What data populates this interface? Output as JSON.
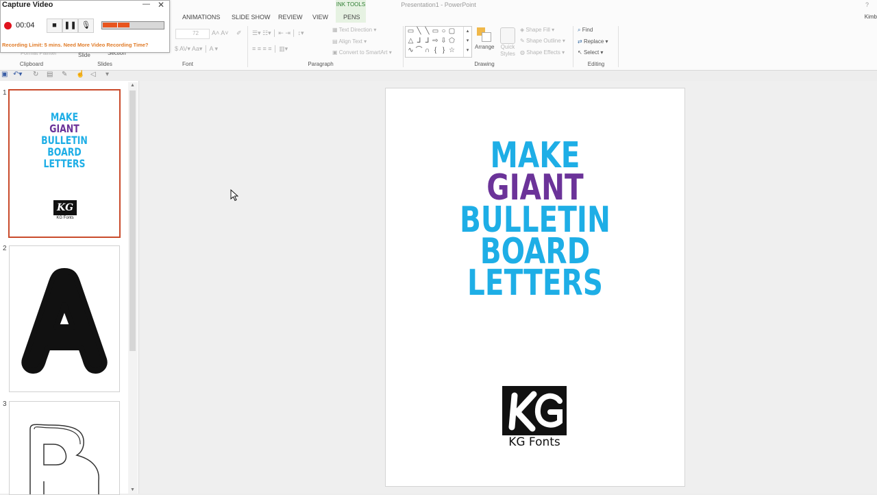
{
  "window": {
    "title": "Presentation1 - PowerPoint",
    "help": "?",
    "user": "Kimb"
  },
  "ribbon": {
    "context_tab_group": "INK TOOLS",
    "tabs": [
      "ANIMATIONS",
      "SLIDE SHOW",
      "REVIEW",
      "VIEW",
      "PENS"
    ],
    "clipboard": {
      "format_painter": "Format Painter",
      "label": "Clipboard"
    },
    "slides": {
      "slide": "Slide",
      "section": "Section",
      "label": "Slides"
    },
    "font": {
      "size": "72",
      "label": "Font"
    },
    "paragraph": {
      "text_direction": "Text Direction",
      "align_text": "Align Text",
      "convert_smartart": "Convert to SmartArt",
      "label": "Paragraph"
    },
    "drawing": {
      "arrange": "Arrange",
      "quick_styles": "Quick Styles",
      "shape_fill": "Shape Fill",
      "shape_outline": "Shape Outline",
      "shape_effects": "Shape Effects",
      "label": "Drawing"
    },
    "editing": {
      "find": "Find",
      "replace": "Replace",
      "select": "Select",
      "label": "Editing"
    }
  },
  "capture": {
    "title": "Capture Video",
    "time": "00:04",
    "level_percent": 45,
    "warning": "Recording Limit: 5 mins. Need More Video Recording Time?"
  },
  "thumbnails": [
    {
      "number": "1",
      "lines": [
        "MAKE",
        "GIANT",
        "BULLETIN",
        "BOARD",
        "LETTERS"
      ],
      "logo_text": "KG Fonts"
    },
    {
      "number": "2",
      "letter": "A"
    },
    {
      "number": "3",
      "letter": "B"
    }
  ],
  "slide": {
    "lines": [
      "MAKE",
      "GIANT",
      "BULLETIN",
      "BOARD",
      "LETTERS"
    ],
    "logo_text": "KG Fonts",
    "colors": {
      "blue": "#1eaee6",
      "purple": "#6b3399"
    }
  }
}
